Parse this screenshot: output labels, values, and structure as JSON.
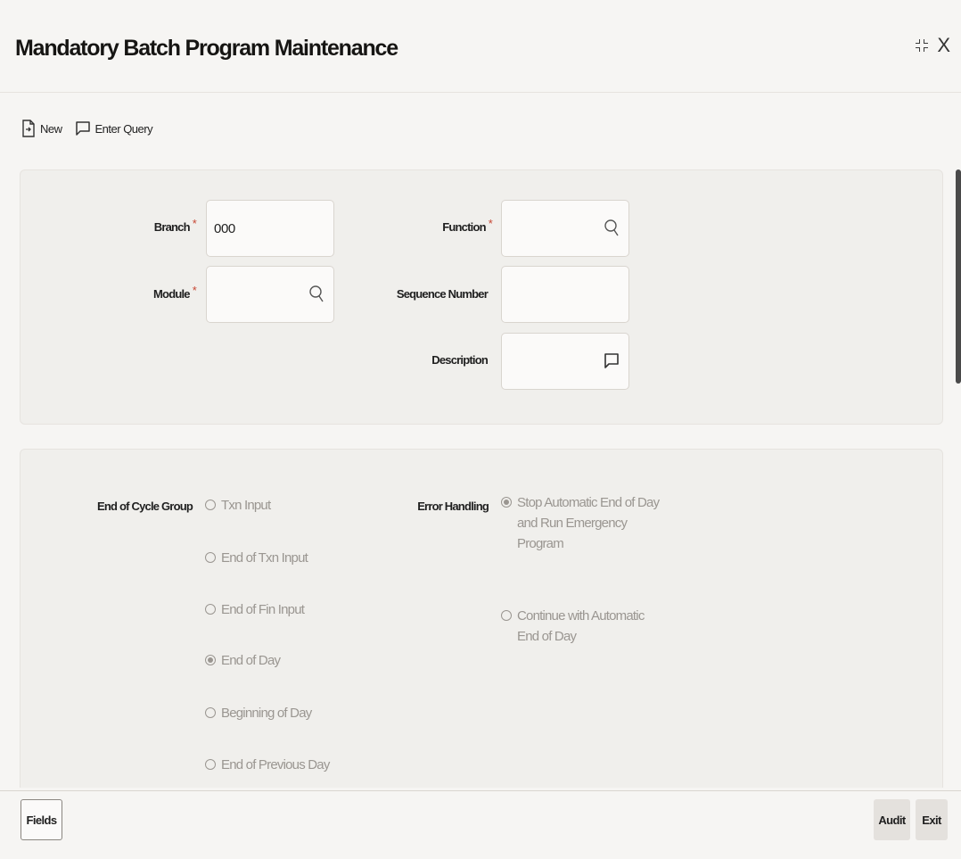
{
  "window": {
    "title": "Mandatory Batch Program Maintenance",
    "restore_icon": "restore-icon",
    "close_label": "X"
  },
  "toolbar": {
    "new_label": "New",
    "enter_query_label": "Enter Query"
  },
  "form": {
    "branch_label": "Branch",
    "branch_value": "000",
    "module_label": "Module",
    "module_value": "",
    "function_label": "Function",
    "function_value": "",
    "sequence_label": "Sequence Number",
    "sequence_value": "",
    "description_label": "Description",
    "description_value": "",
    "required_mark": "*"
  },
  "options": {
    "eoc_label": "End of Cycle Group",
    "eoc_items": [
      {
        "label": "Txn Input",
        "selected": false
      },
      {
        "label": "End of Txn Input",
        "selected": false
      },
      {
        "label": "End of Fin Input",
        "selected": false
      },
      {
        "label": "End of Day",
        "selected": true
      },
      {
        "label": "Beginning of Day",
        "selected": false
      },
      {
        "label": "End of Previous Day",
        "selected": false
      }
    ],
    "error_label": "Error Handling",
    "error_items": [
      {
        "label_lines": [
          "Stop Automatic End of Day",
          "and Run Emergency",
          "Program"
        ],
        "selected": true
      },
      {
        "label_lines": [
          "Continue with Automatic",
          "End of Day"
        ],
        "selected": false
      }
    ]
  },
  "footer": {
    "fields_label": "Fields",
    "audit_label": "Audit",
    "exit_label": "Exit"
  }
}
